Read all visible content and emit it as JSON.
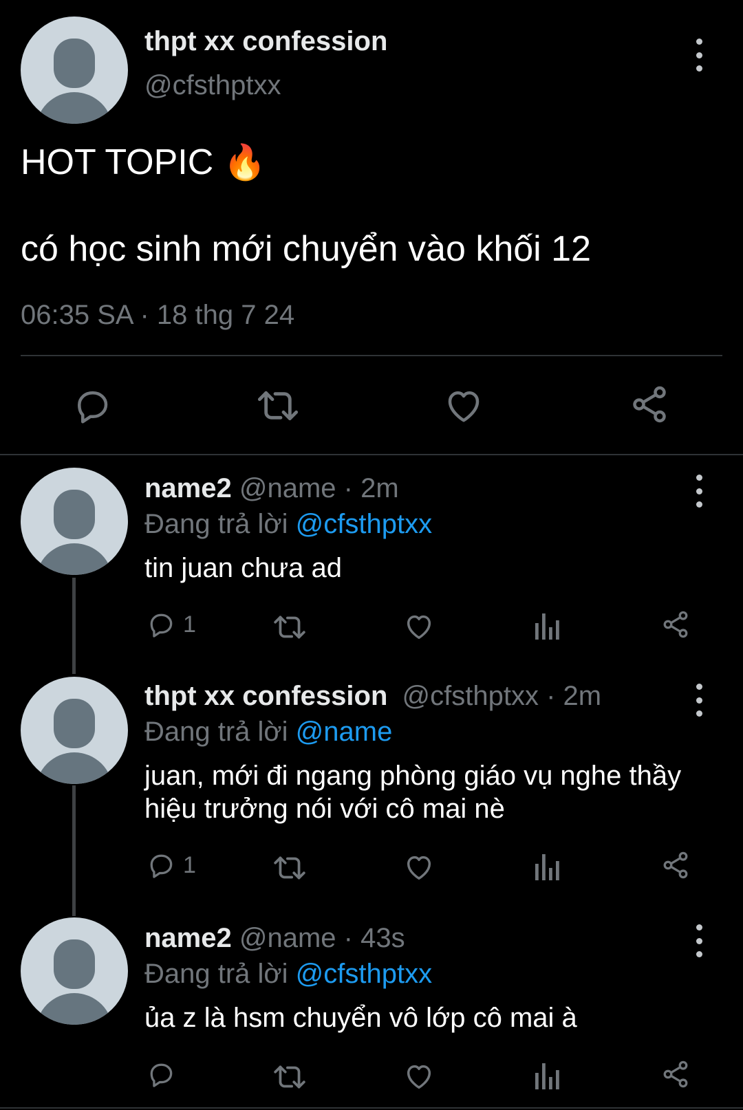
{
  "main_tweet": {
    "display_name": "thpt xx confession",
    "handle": "@cfsthptxx",
    "line1": "HOT TOPIC",
    "line1_emoji": "🔥",
    "line2": "có học sinh mới chuyển vào khối 12",
    "timestamp": "06:35 SA · 18 thg 7 24"
  },
  "replies": [
    {
      "display_name": "name2",
      "handle_time": "@name · 2m",
      "reply_prefix": "Đang trả lời",
      "reply_to": "@cfsthptxx",
      "text": "tin juan chưa ad",
      "reply_count": "1"
    },
    {
      "display_name": "thpt xx confession",
      "handle_time": "@cfsthptxx · 2m",
      "reply_prefix": "Đang trả lời",
      "reply_to": "@name",
      "text_line1": "juan, mới đi ngang phòng giáo vụ nghe thầy",
      "text_line2": "hiệu trưởng nói với cô mai nè",
      "reply_count": "1"
    },
    {
      "display_name": "name2",
      "handle_time": "@name · 43s",
      "reply_prefix": "Đang trả lời",
      "reply_to": "@cfsthptxx",
      "text": "ủa z là hsm chuyển vô lớp cô mai à",
      "reply_count": ""
    }
  ],
  "colors": {
    "background": "#000000",
    "text_primary": "#e7e9ea",
    "text_secondary": "#71767b",
    "link": "#1d9bf0",
    "avatar_bg": "#ccd6dd",
    "avatar_fg": "#66757f"
  },
  "icons": [
    "reply-icon",
    "retweet-icon",
    "like-icon",
    "views-icon",
    "share-icon",
    "more-icon",
    "fire-emoji"
  ]
}
